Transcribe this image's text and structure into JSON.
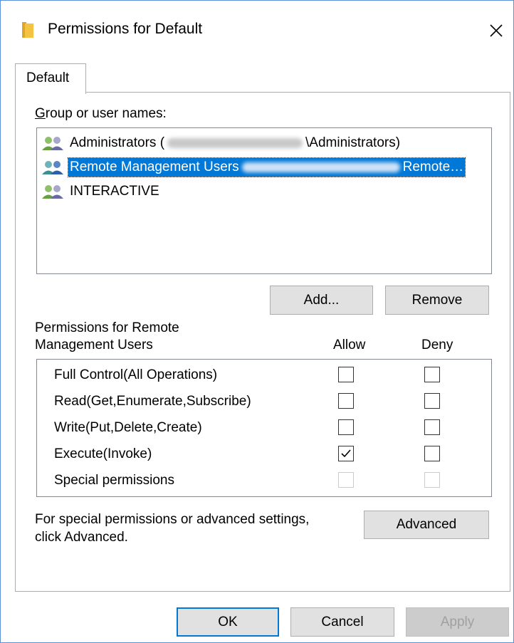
{
  "window": {
    "title": "Permissions for Default",
    "close_label": "✕"
  },
  "tab": {
    "label": "Default"
  },
  "users_section": {
    "label": "Group or user names:",
    "items": [
      {
        "prefix": "Administrators (",
        "suffix": "\\Administrators)",
        "selected": false
      },
      {
        "prefix": "Remote Management Users",
        "suffix": "Remote…",
        "selected": true
      },
      {
        "prefix": "INTERACTIVE",
        "suffix": "",
        "selected": false
      }
    ],
    "add_label": "Add...",
    "remove_label": "Remove"
  },
  "permissions": {
    "header_line1": "Permissions for Remote",
    "header_line2": "Management Users",
    "allow_label": "Allow",
    "deny_label": "Deny",
    "rows": [
      {
        "name": "Full Control(All Operations)",
        "allow": false,
        "deny": false,
        "enabled": true
      },
      {
        "name": "Read(Get,Enumerate,Subscribe)",
        "allow": false,
        "deny": false,
        "enabled": true
      },
      {
        "name": "Write(Put,Delete,Create)",
        "allow": false,
        "deny": false,
        "enabled": true
      },
      {
        "name": "Execute(Invoke)",
        "allow": true,
        "deny": false,
        "enabled": true
      },
      {
        "name": "Special permissions",
        "allow": false,
        "deny": false,
        "enabled": false
      }
    ]
  },
  "advanced": {
    "text_line1": "For special permissions or advanced settings,",
    "text_line2": "click Advanced.",
    "button_label": "Advanced"
  },
  "footer": {
    "ok_label": "OK",
    "cancel_label": "Cancel",
    "apply_label": "Apply"
  },
  "colors": {
    "selection": "#0078d7",
    "folder": "#f5c342",
    "window_border": "#5b8fd6"
  },
  "icons": {
    "folder": "folder-icon",
    "user_group": "user-group-icon",
    "close": "close-icon",
    "checkmark": "checkmark-icon"
  }
}
